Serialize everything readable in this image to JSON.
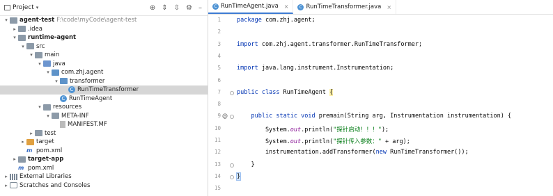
{
  "project_panel": {
    "title": "Project",
    "toolbar_icons": [
      "crosshair-icon",
      "collapse-icon",
      "expand-icon",
      "gear-icon",
      "hide-icon"
    ]
  },
  "tree": [
    {
      "label": "agent-test",
      "path": "F:\\code\\myCode\\agent-test",
      "bold": true,
      "icon": "folder",
      "arrow": "down",
      "level": 0
    },
    {
      "label": ".idea",
      "icon": "folder",
      "arrow": "right",
      "level": 1
    },
    {
      "label": "runtime-agent",
      "bold": true,
      "icon": "folder",
      "arrow": "down",
      "level": 1
    },
    {
      "label": "src",
      "icon": "folder",
      "arrow": "down",
      "level": 2
    },
    {
      "label": "main",
      "icon": "folder",
      "arrow": "down",
      "level": 3
    },
    {
      "label": "java",
      "icon": "folder-source",
      "arrow": "down",
      "level": 4
    },
    {
      "label": "com.zhj.agent",
      "icon": "package",
      "arrow": "down",
      "level": 5
    },
    {
      "label": "transformer",
      "icon": "package",
      "arrow": "down",
      "level": 6
    },
    {
      "label": "RunTimeTransformer",
      "icon": "class",
      "arrow": "",
      "level": 7,
      "selected": true
    },
    {
      "label": "RunTimeAgent",
      "icon": "class",
      "arrow": "",
      "level": 6
    },
    {
      "label": "resources",
      "icon": "folder-resources",
      "arrow": "down",
      "level": 4
    },
    {
      "label": "META-INF",
      "icon": "folder",
      "arrow": "down",
      "level": 5
    },
    {
      "label": "MANIFEST.MF",
      "icon": "file",
      "arrow": "",
      "level": 6
    },
    {
      "label": "test",
      "icon": "folder",
      "arrow": "right",
      "level": 3
    },
    {
      "label": "target",
      "icon": "folder-excluded",
      "arrow": "right",
      "level": 2
    },
    {
      "label": "pom.xml",
      "icon": "maven",
      "arrow": "",
      "level": 2
    },
    {
      "label": "target-app",
      "bold": true,
      "icon": "folder",
      "arrow": "right",
      "level": 1
    },
    {
      "label": "pom.xml",
      "icon": "maven",
      "arrow": "",
      "level": 1
    },
    {
      "label": "External Libraries",
      "icon": "library",
      "arrow": "right",
      "level": 0
    },
    {
      "label": "Scratches and Consoles",
      "icon": "scratch",
      "arrow": "right",
      "level": 0
    }
  ],
  "tabs": [
    {
      "label": "RunTimeAgent.java",
      "active": true
    },
    {
      "label": "RunTimeTransformer.java",
      "active": false
    }
  ],
  "line_numbers": [
    "1",
    "2",
    "3",
    "4",
    "5",
    "6",
    "7",
    "8",
    "9",
    "10",
    "11",
    "12",
    "13",
    "14",
    "15"
  ],
  "code": [
    "package com.zhj.agent;",
    "",
    "import com.zhj.agent.transformer.RunTimeTransformer;",
    "",
    "import java.lang.instrument.Instrumentation;",
    "",
    "public class RunTimeAgent {",
    "",
    "    public static void premain(String arg, Instrumentation instrumentation) {",
    "        System.out.println(\"探针启动！！！\");",
    "        System.out.println(\"探针传入参数：\" + arg);",
    "        instrumentation.addTransformer(new RunTimeTransformer());",
    "    }",
    "}",
    ""
  ],
  "gutter_annotation": "@"
}
